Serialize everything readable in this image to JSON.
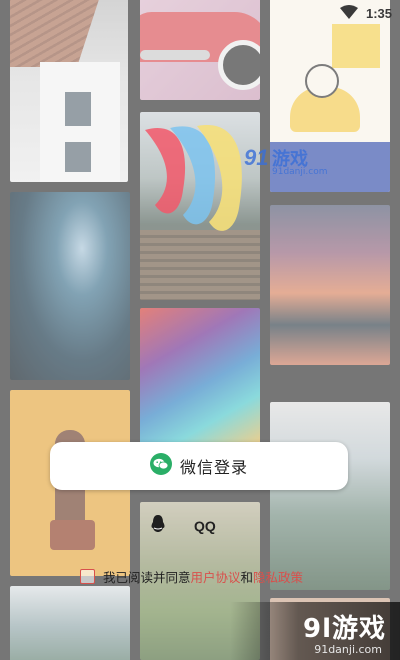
{
  "status_bar": {
    "time": "1:35",
    "wifi_icon": "wifi-icon"
  },
  "watermark_top": {
    "number": "91",
    "brand": "游戏",
    "url": "91danji.com"
  },
  "login": {
    "wechat_label": "微信登录",
    "wechat_icon": "wechat-icon",
    "qq_label": "QQ",
    "qq_icon": "qq-penguin-icon"
  },
  "agreement": {
    "prefix": "我已阅读并同意",
    "user_agreement": "用户协议",
    "and": "和",
    "privacy_policy": "隐私政策"
  },
  "watermark_bottom": {
    "brand": "9l游戏",
    "url": "91danji.com"
  },
  "colors": {
    "wechat_green": "#2aae67",
    "link_red": "#d8504c",
    "watermark_blue": "#3a6fd8"
  }
}
